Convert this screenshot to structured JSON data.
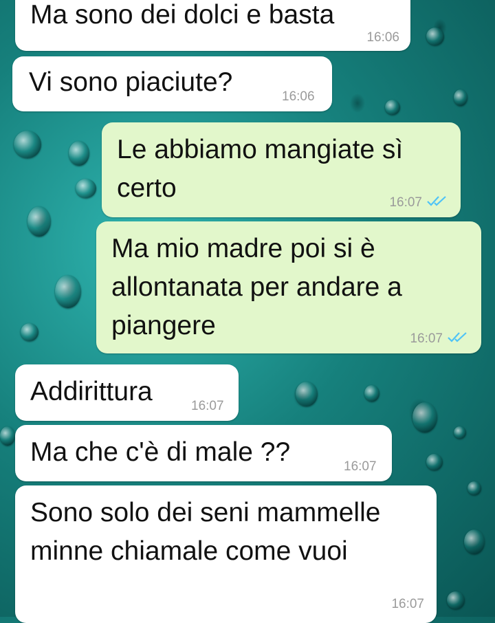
{
  "chat": {
    "messages": [
      {
        "direction": "incoming",
        "text": "Ma sono dei dolci e basta",
        "time": "16:06"
      },
      {
        "direction": "incoming",
        "text": "Vi sono piaciute?",
        "time": "16:06"
      },
      {
        "direction": "outgoing",
        "text": "Le abbiamo mangiate sì certo",
        "time": "16:07",
        "status": "read-double-check-icon"
      },
      {
        "direction": "outgoing",
        "text": "Ma mio madre poi si è allontanata per andare a piangere",
        "time": "16:07",
        "status": "read-double-check-icon"
      },
      {
        "direction": "incoming",
        "text": "Addirittura",
        "time": "16:07"
      },
      {
        "direction": "incoming",
        "text": "Ma che c'è di male ??",
        "time": "16:07"
      },
      {
        "direction": "incoming",
        "text": "Sono solo dei seni mammelle minne chiamale come vuoi",
        "time": "16:07"
      }
    ]
  },
  "colors": {
    "incoming_bubble": "#ffffff",
    "outgoing_bubble": "#e2f7cb",
    "timestamp": "#9a9a9a",
    "read_check": "#4fc3f7",
    "wallpaper": "#16807c"
  }
}
